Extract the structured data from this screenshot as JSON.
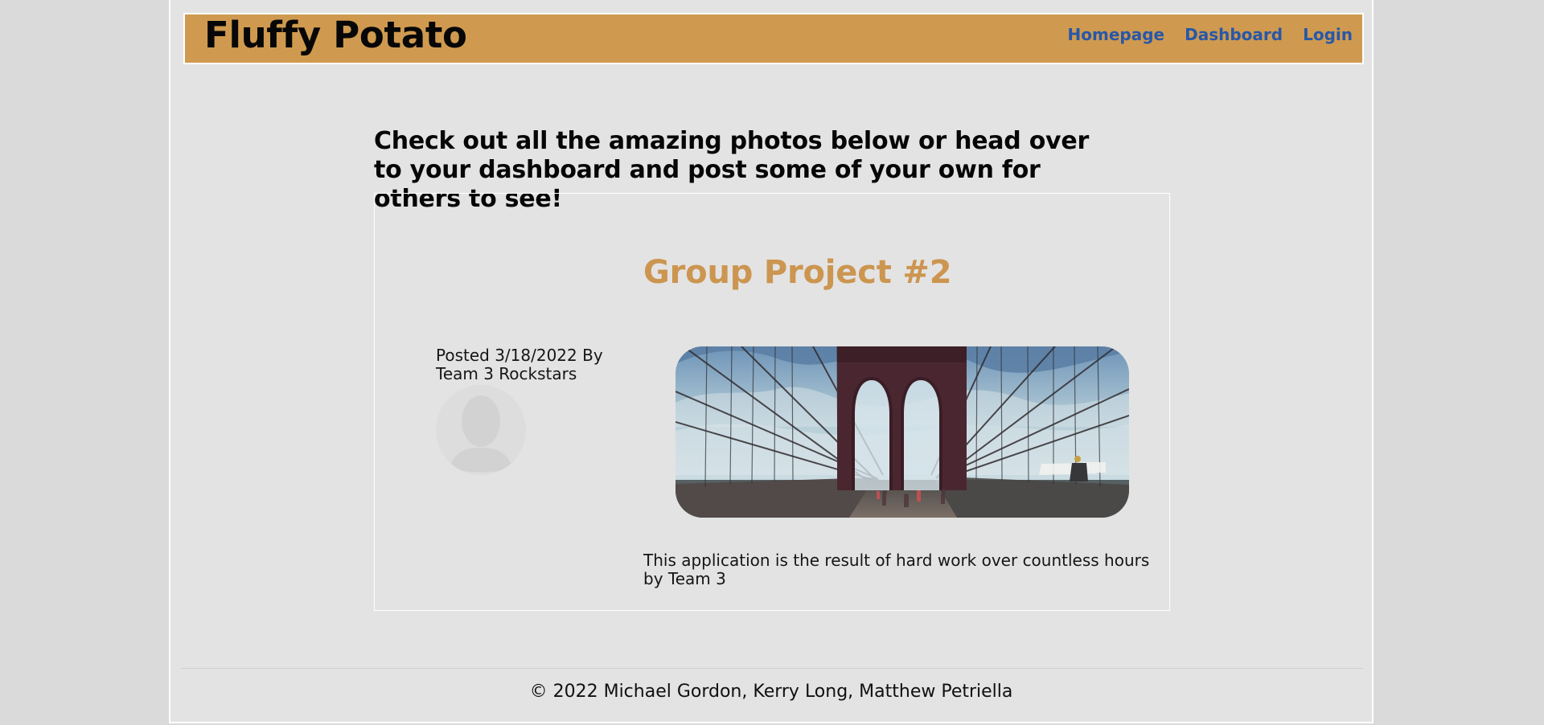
{
  "header": {
    "title": "Fluffy Potato",
    "nav": [
      "Homepage",
      "Dashboard",
      "Login"
    ]
  },
  "main": {
    "intro": "Check out all the amazing photos below or head over to your dashboard and post some of your own for others to see!",
    "post": {
      "title": "Group Project #2",
      "meta": "Posted 3/18/2022 By Team 3 Rockstars",
      "body": "This application is the result of hard work over countless hours by Team 3"
    }
  },
  "footer": {
    "text": "© 2022 Michael Gordon, Kerry Long, Matthew Petriella"
  },
  "colors": {
    "header": "#cf9a4f",
    "link": "#2857a8",
    "title": "#cc9550",
    "page": "#e3e3e3"
  },
  "icons": {
    "avatar": "avatar-icon",
    "photo": "bridge-photo"
  }
}
